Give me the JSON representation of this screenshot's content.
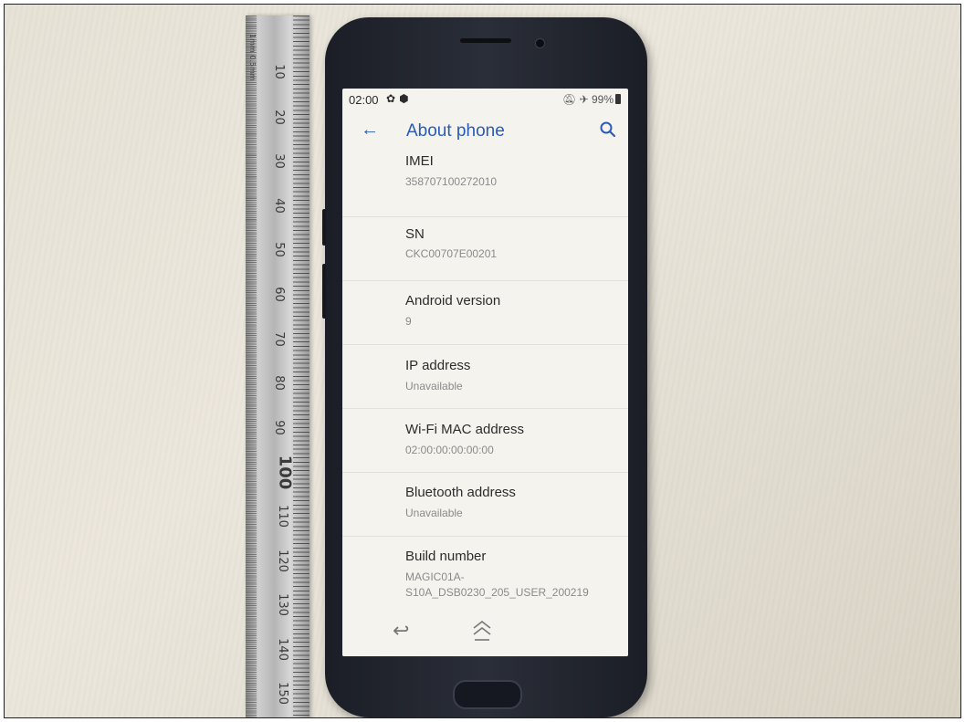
{
  "ruler": {
    "unit_label": "1mm  0.5mm",
    "numbers": [
      "10",
      "20",
      "30",
      "40",
      "50",
      "60",
      "70",
      "80",
      "90",
      "100",
      "110",
      "120",
      "130",
      "140",
      "150"
    ]
  },
  "status_bar": {
    "time": "02:00",
    "left_icons": [
      "gear-icon",
      "shield-icon"
    ],
    "battery": "99%",
    "right_icons": [
      "mute-icon",
      "airplane-icon",
      "battery-icon"
    ]
  },
  "toolbar": {
    "title": "About phone",
    "back_icon": "arrow-left-icon",
    "search_icon": "search-icon"
  },
  "items": [
    {
      "title": "IMEI",
      "value": "358707100272010"
    },
    {
      "title": "SN",
      "value": "CKC00707E00201"
    },
    {
      "title": "Android version",
      "value": "9"
    },
    {
      "title": "IP address",
      "value": "Unavailable"
    },
    {
      "title": "Wi-Fi MAC address",
      "value": "02:00:00:00:00:00"
    },
    {
      "title": "Bluetooth address",
      "value": "Unavailable"
    },
    {
      "title": "Build number",
      "value": "MAGIC01A-\nS10A_DSB0230_205_USER_200219"
    }
  ],
  "nav_bar": {
    "back_icon": "nav-back-icon",
    "home_icon": "nav-home-icon"
  },
  "colors": {
    "accent": "#2a5bb8",
    "screen_bg": "#f4f3ee",
    "phone_body": "#1b1e26"
  }
}
